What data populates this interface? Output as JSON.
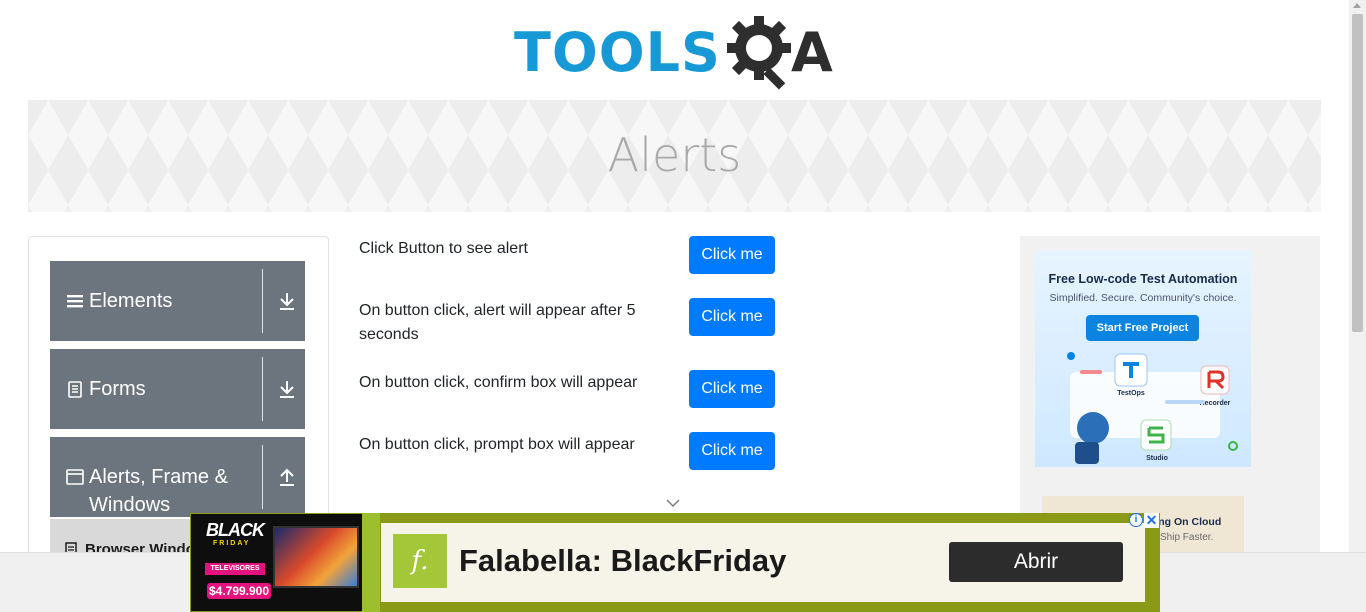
{
  "header": {
    "logo_text_primary": "TOOLS",
    "logo_text_secondary": "A",
    "brand_color": "#1799d6",
    "logo_dark_color": "#2e2e2e"
  },
  "banner": {
    "title": "Alerts"
  },
  "sidebar": {
    "groups": [
      {
        "label": "Elements",
        "icon": "hamburger-icon",
        "arrow": "download-arrow-icon"
      },
      {
        "label": "Forms",
        "icon": "document-icon",
        "arrow": "download-arrow-icon"
      },
      {
        "label": "Alerts, Frame & Windows",
        "icon": "window-icon",
        "arrow": "upload-arrow-icon"
      }
    ],
    "sub_items": [
      {
        "label": "Browser Windows",
        "icon": "document-icon"
      }
    ]
  },
  "alerts": {
    "rows": [
      {
        "text": "Click Button to see alert",
        "button": "Click me"
      },
      {
        "text": "On button click, alert will appear after 5 seconds",
        "button": "Click me"
      },
      {
        "text": "On button click, confirm box will appear",
        "button": "Click me"
      },
      {
        "text": "On button click, prompt box will appear",
        "button": "Click me"
      }
    ],
    "button_color": "#007bff"
  },
  "right_ad": {
    "title": "Free Low-code Test Automation",
    "subtitle": "Simplified. Secure. Community's choice.",
    "cta": "Start Free Project",
    "labels": [
      "TestOps",
      "Recorder",
      "Studio"
    ],
    "secondary_title": "Hosting On Cloud",
    "secondary_sub": "Ship Faster."
  },
  "bottom_ad": {
    "promo_black": "BLACK",
    "promo_friday": "FRIDAY",
    "promo_category": "TELEVISORES",
    "promo_price": "$4.799.900",
    "brand_initial": "f.",
    "headline": "Falabella: BlackFriday",
    "cta": "Abrir",
    "info_icon": "i",
    "close_icon": "✕"
  }
}
